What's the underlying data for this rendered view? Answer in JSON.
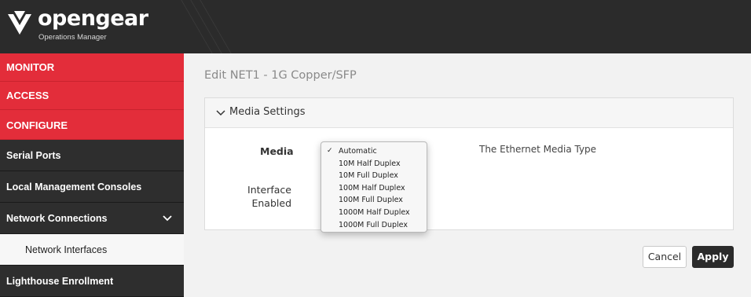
{
  "brand": {
    "name": "opengear",
    "subtitle": "Operations Manager"
  },
  "sidebar": {
    "items": [
      {
        "label": "MONITOR"
      },
      {
        "label": "ACCESS"
      },
      {
        "label": "CONFIGURE"
      },
      {
        "label": "Serial Ports"
      },
      {
        "label": "Local Management Consoles"
      },
      {
        "label": "Network Connections"
      },
      {
        "label": "Network Interfaces"
      },
      {
        "label": "Lighthouse Enrollment"
      }
    ]
  },
  "main": {
    "title": "Edit NET1 - 1G Copper/SFP",
    "section_title": "Media Settings",
    "media_label": "Media",
    "media_help": "The Ethernet Media Type",
    "interface_label": "Interface Enabled",
    "media_options": [
      {
        "label": "Automatic",
        "selected": true
      },
      {
        "label": "10M Half Duplex",
        "selected": false
      },
      {
        "label": "10M Full Duplex",
        "selected": false
      },
      {
        "label": "100M Half Duplex",
        "selected": false
      },
      {
        "label": "100M Full Duplex",
        "selected": false
      },
      {
        "label": "1000M Half Duplex",
        "selected": false
      },
      {
        "label": "1000M Full Duplex",
        "selected": false
      }
    ],
    "cancel_label": "Cancel",
    "apply_label": "Apply"
  },
  "colors": {
    "header_bg": "#2b2b2b",
    "accent_red": "#e32d3a",
    "sidebar_bg": "#2e2e2e"
  }
}
